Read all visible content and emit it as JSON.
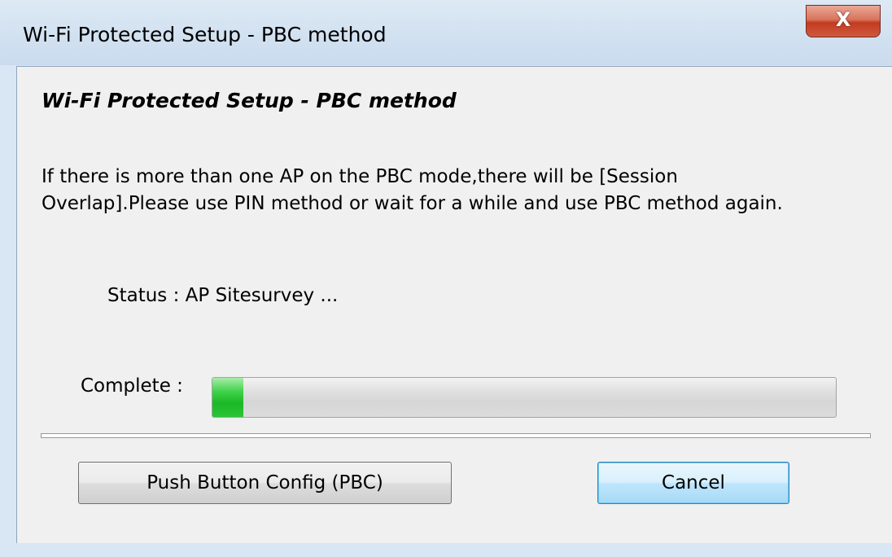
{
  "window": {
    "title": "Wi-Fi Protected Setup - PBC method",
    "close_glyph": "X"
  },
  "dialog": {
    "heading": "Wi-Fi Protected Setup - PBC method",
    "message_line1": "If there is more than one AP on the PBC mode,there will be [Session",
    "message_line2": "Overlap].Please use PIN method or wait for a while and use PBC method again.",
    "status_text": "Status : AP Sitesurvey ...",
    "complete_label": "Complete :",
    "progress_fraction": 0.05
  },
  "buttons": {
    "pbc_label": "Push Button Config (PBC)",
    "cancel_label": "Cancel"
  },
  "colors": {
    "progress_fill": "#1bb827",
    "close_button": "#c23b1f",
    "title_bar": "#d3e2f1",
    "dialog_background": "#f0f0f0"
  },
  "icons": {
    "close": "close-icon"
  }
}
